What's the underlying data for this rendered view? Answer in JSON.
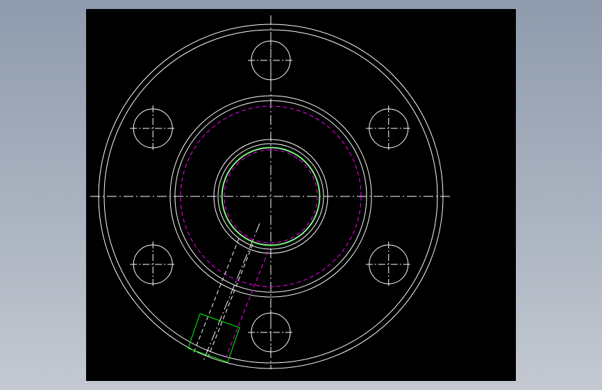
{
  "view": {
    "type": "cad-2d-drawing",
    "subject": "flange-front-view"
  },
  "colors": {
    "app_background_top": "#8f9bad",
    "app_background_bottom": "#c4c9d1",
    "viewport_background": "#000000",
    "geometry_line": "#ffffff",
    "centerline": "#ffffff",
    "hidden_line": "#ff00ff",
    "thread_line": "#00ff00"
  },
  "flange": {
    "bolt_hole_count": 6
  }
}
